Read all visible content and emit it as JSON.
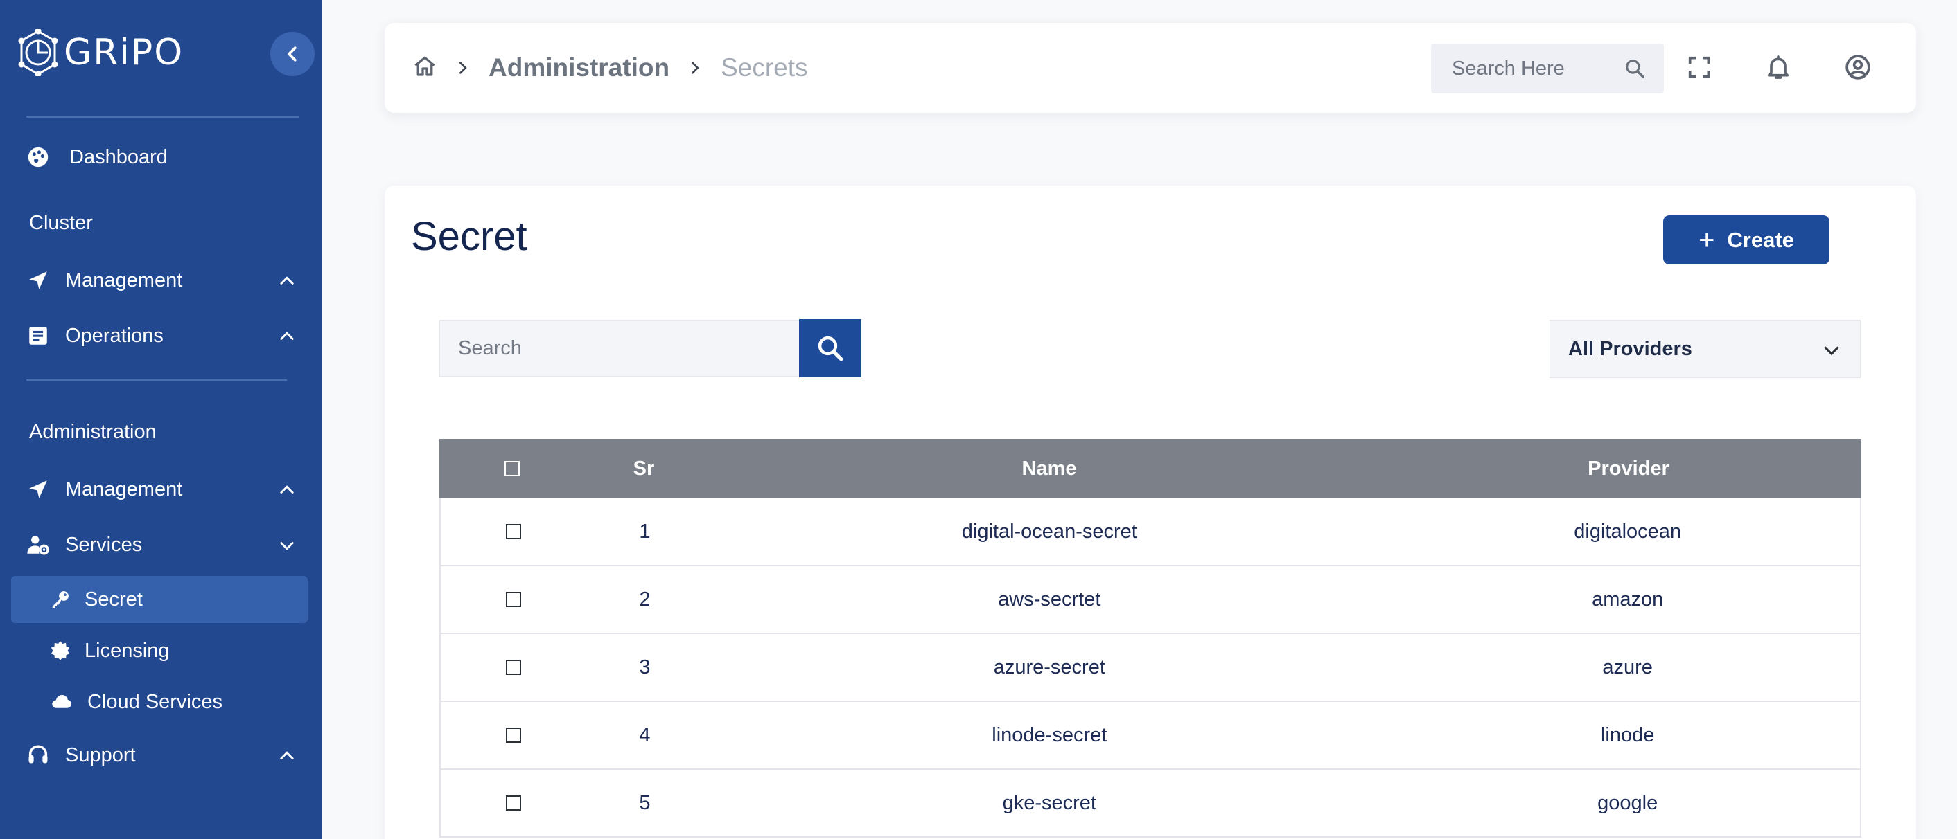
{
  "sidebar": {
    "logo_text": "GRiPO",
    "items": {
      "dashboard": "Dashboard",
      "cluster_label": "Cluster",
      "cluster_management": "Management",
      "cluster_operations": "Operations",
      "administration_label": "Administration",
      "admin_management": "Management",
      "services": "Services",
      "secret": "Secret",
      "licensing": "Licensing",
      "cloud_services": "Cloud Services",
      "support": "Support"
    },
    "active_item": "Secret"
  },
  "topbar": {
    "breadcrumb_section": "Administration",
    "breadcrumb_current": "Secrets",
    "search_placeholder": "Search Here"
  },
  "main": {
    "title": "Secret",
    "create_label": "Create",
    "search_placeholder": "Search",
    "provider_filter": "All Providers",
    "table": {
      "headers": {
        "sr": "Sr",
        "name": "Name",
        "provider": "Provider"
      },
      "rows": [
        {
          "sr": "1",
          "name": "digital-ocean-secret",
          "provider": "digitalocean"
        },
        {
          "sr": "2",
          "name": "aws-secrtet",
          "provider": "amazon"
        },
        {
          "sr": "3",
          "name": "azure-secret",
          "provider": "azure"
        },
        {
          "sr": "4",
          "name": "linode-secret",
          "provider": "linode"
        },
        {
          "sr": "5",
          "name": "gke-secret",
          "provider": "google"
        }
      ]
    }
  },
  "colors": {
    "sidebar_bg": "#22488f",
    "primary": "#1d4b99",
    "table_header_bg": "#7c8189",
    "active_item_bg": "#3560ab"
  },
  "icons": [
    "gear-logo-icon",
    "chevron-left-icon",
    "palette-icon",
    "send-icon",
    "file-text-icon",
    "user-gear-icon",
    "key-icon",
    "badge-icon",
    "cloud-icon",
    "headset-icon",
    "chevron-up-icon",
    "chevron-down-icon",
    "home-icon",
    "chevron-right-icon",
    "search-icon",
    "fullscreen-icon",
    "bell-icon",
    "user-circle-icon",
    "plus-icon"
  ]
}
